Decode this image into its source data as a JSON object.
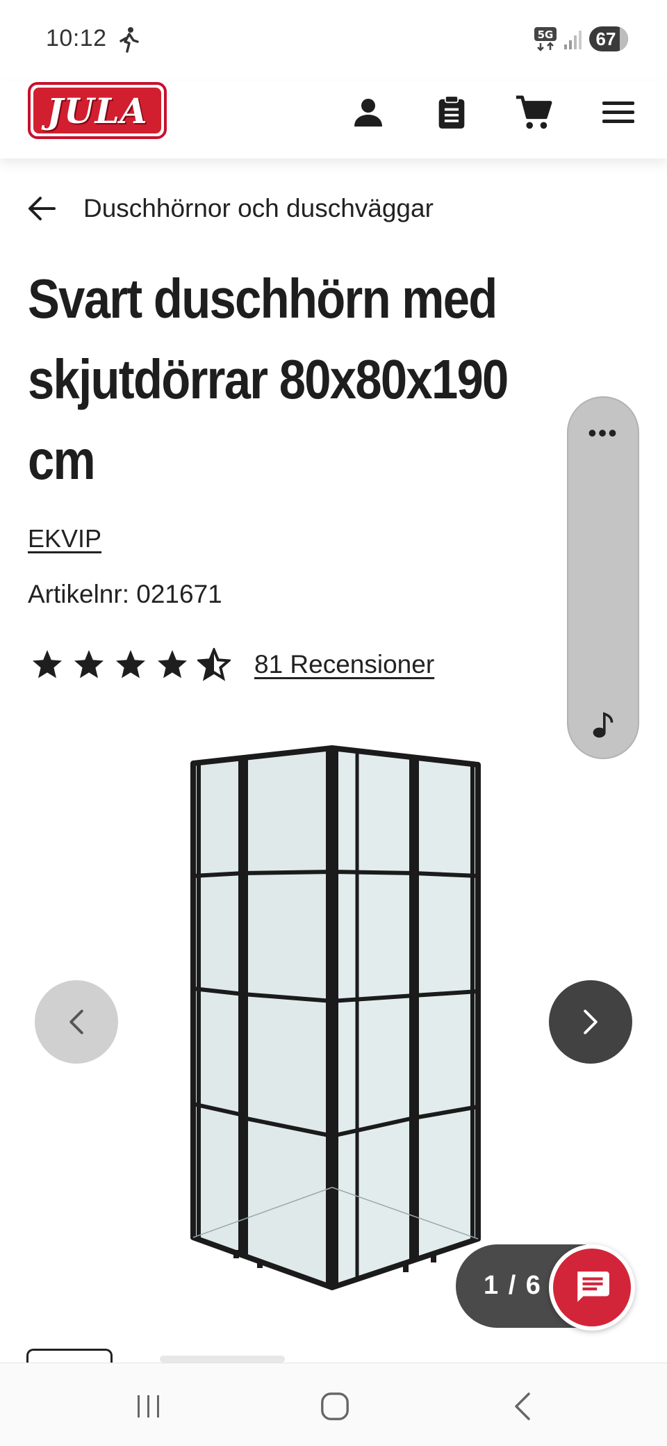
{
  "status_bar": {
    "time": "10:12",
    "network": "5G",
    "battery": "67",
    "icons": [
      "walking-icon",
      "5g-icon",
      "signal-icon",
      "battery-icon"
    ]
  },
  "header": {
    "logo_text": "JULA",
    "icons": [
      "account-icon",
      "clipboard-icon",
      "cart-icon",
      "menu-icon"
    ],
    "brand_color": "#d21f2f"
  },
  "breadcrumb": {
    "label": "Duschhörnor och duschväggar"
  },
  "product": {
    "title": "Svart duschhörn med skjutdörrar 80x80x190 cm",
    "brand": "EKVIP",
    "article_number": "Artikelnr: 021671",
    "rating": 4.5,
    "rating_max": 5,
    "reviews": "81 Recensioner"
  },
  "gallery": {
    "counter": "1 / 6",
    "current": 1,
    "total": 6
  },
  "side_panel": {
    "more_label": "•••"
  },
  "colors": {
    "accent_red": "#d3253a",
    "dark_button": "#424242",
    "light_button": "#d0d0d0"
  }
}
